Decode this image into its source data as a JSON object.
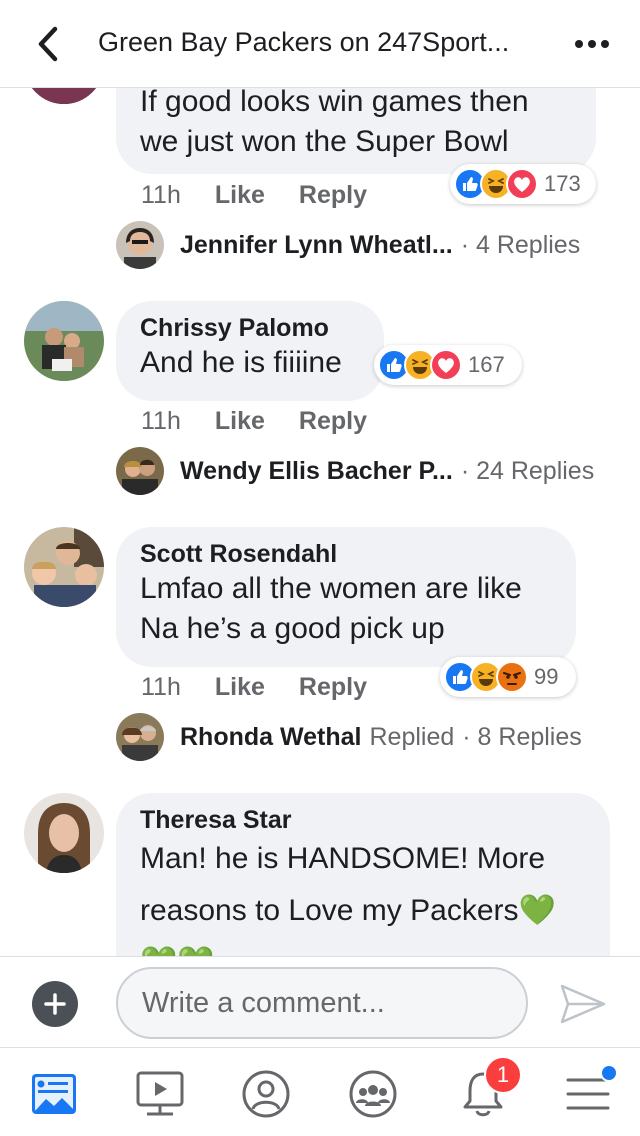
{
  "header": {
    "title": "Green Bay Packers on 247Sport...",
    "back_icon": "chevron-left-icon",
    "more_icon": "more-dots-icon"
  },
  "colors": {
    "like_blue": "#1877f2",
    "haha_yellow": "#f7b125",
    "love_red": "#f33e58",
    "angry_orange": "#e9710f",
    "bubble_gray": "#f0f2f5",
    "secondary_text": "#65676b"
  },
  "comments": [
    {
      "author": "",
      "text": "If good looks  win games then we just won  the Super Bowl",
      "time": "11h",
      "like_label": "Like",
      "reply_label": "Reply",
      "reaction_count": "173",
      "reactions": [
        "like",
        "haha",
        "love"
      ],
      "reply_preview": {
        "name": "Jennifer Lynn Wheatl...",
        "replied": "",
        "count": "· 4 Replies"
      }
    },
    {
      "author": "Chrissy Palomo",
      "text": "And he is fiiiine",
      "time": "11h",
      "like_label": "Like",
      "reply_label": "Reply",
      "reaction_count": "167",
      "reactions": [
        "like",
        "haha",
        "love"
      ],
      "reply_preview": {
        "name": "Wendy Ellis Bacher P...",
        "replied": "",
        "count": "· 24 Replies"
      }
    },
    {
      "author": "Scott Rosendahl",
      "text": "Lmfao all the women are like Na he’s a good pick up",
      "time": "11h",
      "like_label": "Like",
      "reply_label": "Reply",
      "reaction_count": "99",
      "reactions": [
        "like",
        "haha",
        "angry"
      ],
      "reply_preview": {
        "name": "Rhonda Wethal",
        "replied": "Replied",
        "count": "· 8 Replies"
      }
    },
    {
      "author": "Theresa Star",
      "text_line1": "Man! he is HANDSOME! More",
      "text_line2": "reasons to Love my Packers💚",
      "text_line3": "💚💚"
    }
  ],
  "composer": {
    "placeholder": "Write a comment...",
    "add_icon": "plus-circle-icon",
    "send_icon": "send-icon"
  },
  "tabbar": {
    "items": [
      "news-feed-icon",
      "watch-icon",
      "profile-icon",
      "groups-icon",
      "notifications-icon",
      "menu-icon"
    ],
    "notification_badge": "1"
  }
}
